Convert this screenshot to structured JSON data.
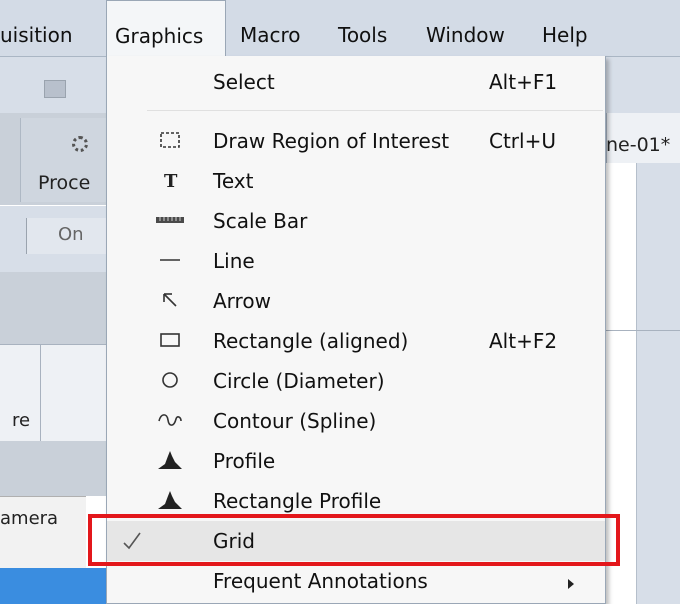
{
  "menubar": {
    "items": [
      "uisition",
      "Graphics",
      "Macro",
      "Tools",
      "Window",
      "Help"
    ]
  },
  "background": {
    "tab_label": "ne-01*",
    "process_label": "Proce",
    "on_label": "On",
    "col_label": "re",
    "camera_label": "amera"
  },
  "menu": {
    "items": [
      {
        "label": "Select",
        "shortcut": "Alt+F1",
        "icon": "none"
      },
      {
        "label": "Draw Region of Interest",
        "shortcut": "Ctrl+U",
        "icon": "roi-dashed-rect-icon"
      },
      {
        "label": "Text",
        "shortcut": "",
        "icon": "text-T-icon"
      },
      {
        "label": "Scale Bar",
        "shortcut": "",
        "icon": "scale-bar-icon"
      },
      {
        "label": "Line",
        "shortcut": "",
        "icon": "line-icon"
      },
      {
        "label": "Arrow",
        "shortcut": "",
        "icon": "arrow-icon"
      },
      {
        "label": "Rectangle (aligned)",
        "shortcut": "Alt+F2",
        "icon": "rectangle-icon"
      },
      {
        "label": "Circle (Diameter)",
        "shortcut": "",
        "icon": "circle-icon"
      },
      {
        "label": "Contour (Spline)",
        "shortcut": "",
        "icon": "spline-icon"
      },
      {
        "label": "Profile",
        "shortcut": "",
        "icon": "profile-icon"
      },
      {
        "label": "Rectangle Profile",
        "shortcut": "",
        "icon": "rectangle-profile-icon"
      },
      {
        "label": "Grid",
        "shortcut": "",
        "icon": "checkmark-icon",
        "checked": true
      },
      {
        "label": "Frequent Annotations",
        "shortcut": "",
        "icon": "none",
        "submenu": true
      }
    ]
  },
  "colors": {
    "highlight": "#e3171b"
  }
}
